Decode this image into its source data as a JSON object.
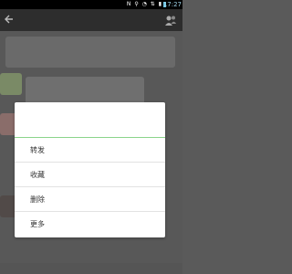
{
  "status_bar": {
    "time": "17:27",
    "icons": "N ⚲ ◔ ⇅ ▮"
  },
  "title_bar": {
    "title": ""
  },
  "chat": {
    "system_message": ""
  },
  "context_menu": {
    "header_name": "",
    "items": [
      "转发",
      "收藏",
      "删除",
      "更多"
    ]
  },
  "colors": {
    "overlay": "#585858",
    "titlebar": "#2d2d2d",
    "accent": "#8bd48b"
  }
}
